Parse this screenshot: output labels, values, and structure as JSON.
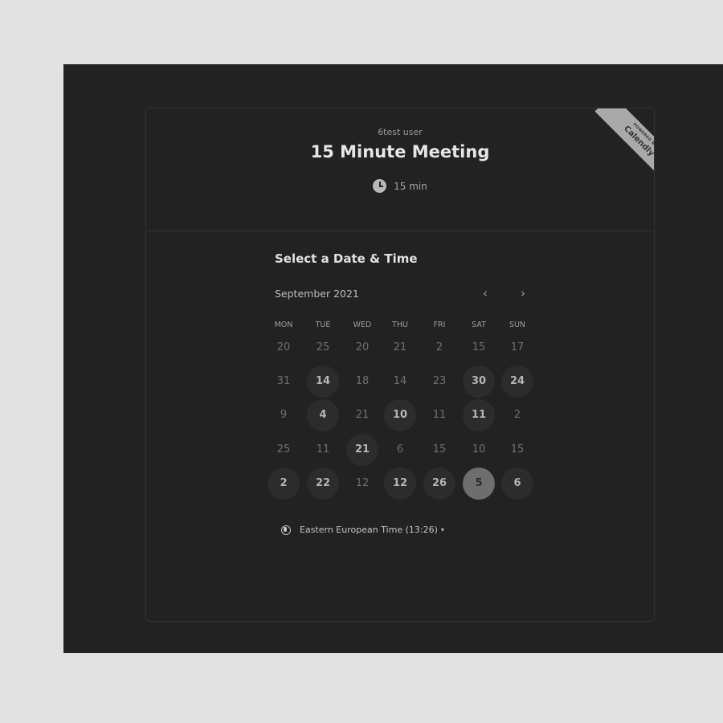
{
  "event": {
    "user_name": "6test user",
    "title": "15 Minute Meeting",
    "duration": "15 min",
    "duration_icon": "clock-icon"
  },
  "badge": {
    "powered_by": "POWERED BY",
    "brand": "Calendly"
  },
  "calendar": {
    "heading": "Select a Date & Time",
    "month": "September 2021",
    "prev_icon": "chevron-left-icon",
    "next_icon": "chevron-right-icon",
    "weekdays": [
      "MON",
      "TUE",
      "WED",
      "THU",
      "FRI",
      "SAT",
      "SUN"
    ],
    "weeks": [
      [
        {
          "d": "20",
          "s": "dim"
        },
        {
          "d": "25",
          "s": "dim"
        },
        {
          "d": "20",
          "s": "dim"
        },
        {
          "d": "21",
          "s": "dim"
        },
        {
          "d": "2",
          "s": "dim"
        },
        {
          "d": "15",
          "s": "dim"
        },
        {
          "d": "17",
          "s": "dim"
        }
      ],
      [
        {
          "d": "31",
          "s": "dim"
        },
        {
          "d": "14",
          "s": "avail"
        },
        {
          "d": "18",
          "s": "dim"
        },
        {
          "d": "14",
          "s": "dim"
        },
        {
          "d": "23",
          "s": "dim"
        },
        {
          "d": "30",
          "s": "avail"
        },
        {
          "d": "24",
          "s": "avail"
        }
      ],
      [
        {
          "d": "9",
          "s": "dim"
        },
        {
          "d": "4",
          "s": "avail"
        },
        {
          "d": "21",
          "s": "dim"
        },
        {
          "d": "10",
          "s": "avail"
        },
        {
          "d": "11",
          "s": "dim"
        },
        {
          "d": "11",
          "s": "avail"
        },
        {
          "d": "2",
          "s": "dim"
        }
      ],
      [
        {
          "d": "25",
          "s": "dim"
        },
        {
          "d": "11",
          "s": "dim"
        },
        {
          "d": "21",
          "s": "avail"
        },
        {
          "d": "6",
          "s": "dim"
        },
        {
          "d": "15",
          "s": "dim"
        },
        {
          "d": "10",
          "s": "dim"
        },
        {
          "d": "15",
          "s": "dim"
        }
      ],
      [
        {
          "d": "2",
          "s": "avail"
        },
        {
          "d": "22",
          "s": "avail"
        },
        {
          "d": "12",
          "s": "dim"
        },
        {
          "d": "12",
          "s": "avail"
        },
        {
          "d": "26",
          "s": "avail"
        },
        {
          "d": "5",
          "s": "selected"
        },
        {
          "d": "6",
          "s": "avail"
        }
      ]
    ]
  },
  "timezone": {
    "label": "Eastern European Time (13:26)",
    "icon": "globe-icon",
    "caret": "▾"
  }
}
